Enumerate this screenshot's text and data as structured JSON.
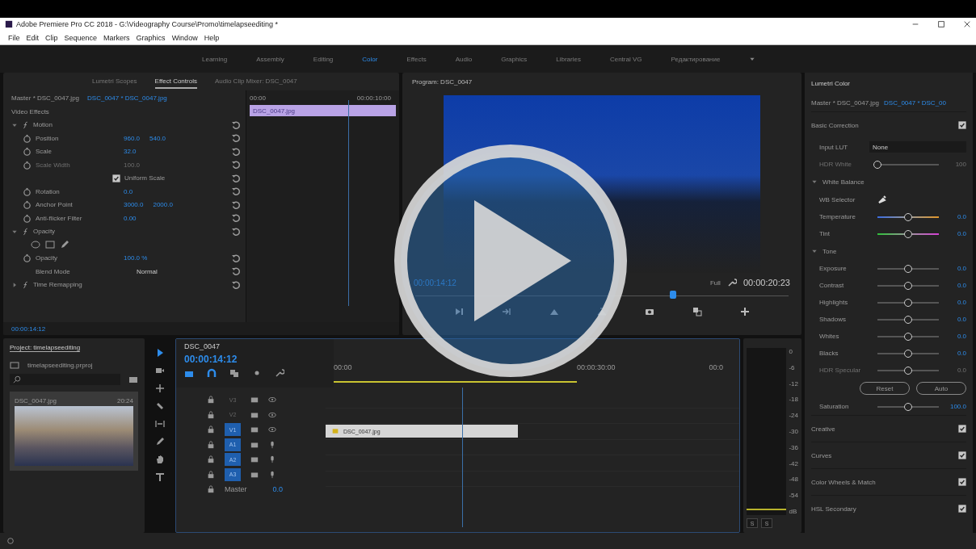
{
  "window": {
    "title": "Adobe Premiere Pro CC 2018 - G:\\Videography Course\\Promo\\timelapseediting *"
  },
  "menu": [
    "File",
    "Edit",
    "Clip",
    "Sequence",
    "Markers",
    "Graphics",
    "Window",
    "Help"
  ],
  "workspaces": [
    {
      "label": "Learning",
      "selected": false
    },
    {
      "label": "Assembly",
      "selected": false
    },
    {
      "label": "Editing",
      "selected": false
    },
    {
      "label": "Color",
      "selected": true
    },
    {
      "label": "Effects",
      "selected": false
    },
    {
      "label": "Audio",
      "selected": false
    },
    {
      "label": "Graphics",
      "selected": false
    },
    {
      "label": "Libraries",
      "selected": false
    },
    {
      "label": "Central VG",
      "selected": false
    },
    {
      "label": "Редактирование",
      "selected": false
    }
  ],
  "effect_panel": {
    "tabs": [
      {
        "label": "Lumetri Scopes",
        "selected": false
      },
      {
        "label": "Effect Controls",
        "selected": true
      },
      {
        "label": "Audio Clip Mixer: DSC_0047",
        "selected": false
      }
    ],
    "master": "Master * DSC_0047.jpg",
    "clip": "DSC_0047 * DSC_0047.jpg",
    "section": "Video Effects",
    "rows": [
      {
        "kind": "group",
        "label": "Motion",
        "expanded": true
      },
      {
        "kind": "param",
        "label": "Position",
        "values": [
          "960.0",
          "540.0"
        ],
        "disabled": false
      },
      {
        "kind": "param",
        "label": "Scale",
        "values": [
          "32.0"
        ],
        "disabled": false
      },
      {
        "kind": "param",
        "label": "Scale Width",
        "values": [
          "100.0"
        ],
        "disabled": true
      },
      {
        "kind": "checkbox",
        "label": "Uniform Scale",
        "checked": true
      },
      {
        "kind": "param",
        "label": "Rotation",
        "values": [
          "0.0"
        ],
        "disabled": false
      },
      {
        "kind": "param",
        "label": "Anchor Point",
        "values": [
          "3000.0",
          "2000.0"
        ],
        "disabled": false
      },
      {
        "kind": "param",
        "label": "Anti-flicker Filter",
        "values": [
          "0.00"
        ],
        "disabled": false
      },
      {
        "kind": "group",
        "label": "Opacity",
        "expanded": true
      },
      {
        "kind": "masks"
      },
      {
        "kind": "param",
        "label": "Opacity",
        "values": [
          "100.0 %"
        ],
        "disabled": false
      },
      {
        "kind": "select",
        "label": "Blend Mode",
        "value": "Normal"
      },
      {
        "kind": "group",
        "label": "Time Remapping",
        "expanded": false
      }
    ],
    "timecode": "00:00:14:12"
  },
  "mini_timeline": {
    "start": "00:00",
    "end": "00:00:10:00",
    "clip": "DSC_0047.jpg"
  },
  "program": {
    "title": "Program: DSC_0047",
    "timecode": "00:00:14:12",
    "zoom": "Full",
    "duration": "00:00:20:23",
    "level": 0.69
  },
  "project": {
    "title": "Project: timelapseediting",
    "file": "timelapseediting.prproj",
    "item": {
      "name": "DSC_0047.jpg",
      "duration": "20:24"
    }
  },
  "timeline": {
    "tab": "DSC_0047",
    "timecode": "00:00:14:12",
    "ruler": [
      "00:00",
      "00:00:30:00",
      "00:0"
    ],
    "tracks": [
      {
        "kind": "video",
        "label": "V3",
        "targeted": false
      },
      {
        "kind": "video",
        "label": "V2",
        "targeted": false
      },
      {
        "kind": "video",
        "label": "V1",
        "targeted": true
      },
      {
        "kind": "audio",
        "label": "A1",
        "targeted": true
      },
      {
        "kind": "audio",
        "label": "A2",
        "targeted": true
      },
      {
        "kind": "audio",
        "label": "A3",
        "targeted": true
      }
    ],
    "master": "Master",
    "master_value": "0.0",
    "clip": "DSC_0047.jpg",
    "level": 0.33
  },
  "meter": {
    "scale": [
      "0",
      "-6",
      "-12",
      "-18",
      "-24",
      "-30",
      "-36",
      "-42",
      "-48",
      "-54",
      "dB"
    ],
    "buttons": [
      "S",
      "S"
    ]
  },
  "lumetri": {
    "title": "Lumetri Color",
    "master": "Master * DSC_0047.jpg",
    "clip": "DSC_0047 * DSC_00",
    "basic": {
      "label": "Basic Correction",
      "checked": true,
      "lut_label": "Input LUT",
      "lut_value": "None",
      "hdr": {
        "label": "HDR White",
        "value": "100",
        "level": 0.0,
        "disabled": true
      },
      "white_balance": {
        "label": "White Balance",
        "expanded": true,
        "selector": "WB Selector",
        "sliders": [
          {
            "kind": "temperature",
            "label": "Temperature",
            "value": "0.0",
            "level": 0.5
          },
          {
            "kind": "tint",
            "label": "Tint",
            "value": "0.0",
            "level": 0.5
          }
        ]
      },
      "tone": {
        "label": "Tone",
        "expanded": true,
        "sliders": [
          {
            "label": "Exposure",
            "value": "0.0",
            "level": 0.5,
            "disabled": false
          },
          {
            "label": "Contrast",
            "value": "0.0",
            "level": 0.5,
            "disabled": false
          },
          {
            "label": "Highlights",
            "value": "0.0",
            "level": 0.5,
            "disabled": false
          },
          {
            "label": "Shadows",
            "value": "0.0",
            "level": 0.5,
            "disabled": false
          },
          {
            "label": "Whites",
            "value": "0.0",
            "level": 0.5,
            "disabled": false
          },
          {
            "label": "Blacks",
            "value": "0.0",
            "level": 0.5,
            "disabled": false
          },
          {
            "label": "HDR Specular",
            "value": "0.0",
            "level": 0.5,
            "disabled": true
          }
        ]
      },
      "buttons": [
        "Reset",
        "Auto"
      ],
      "saturation": {
        "label": "Saturation",
        "value": "100.0",
        "level": 0.5
      }
    },
    "sections": [
      {
        "label": "Creative",
        "checked": true
      },
      {
        "label": "Curves",
        "checked": true
      },
      {
        "label": "Color Wheels & Match",
        "checked": true
      },
      {
        "label": "HSL Secondary",
        "checked": true
      }
    ]
  }
}
